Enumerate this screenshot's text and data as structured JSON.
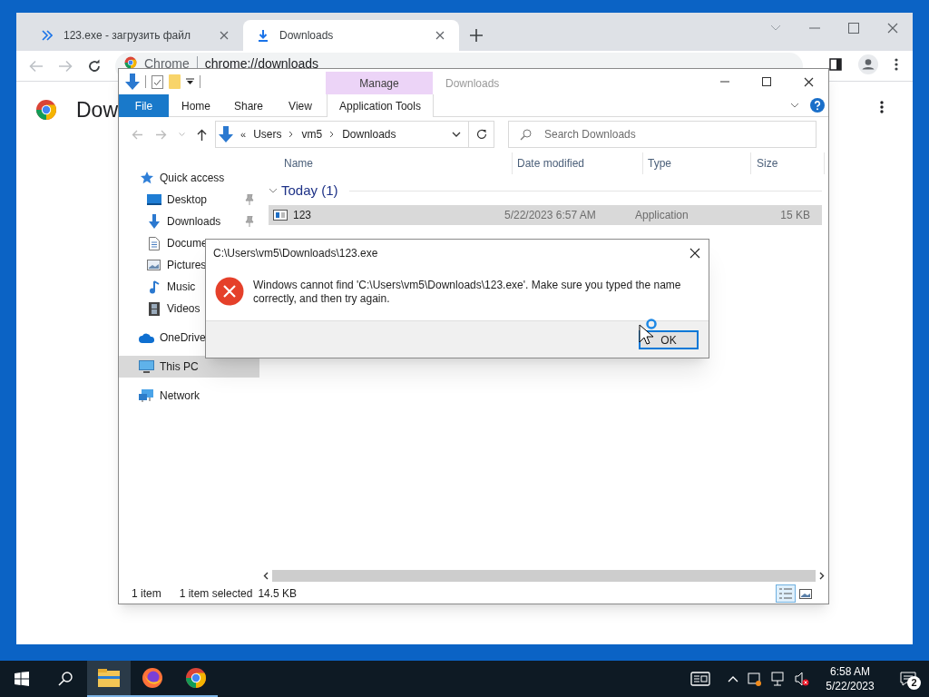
{
  "browser": {
    "tabs": [
      {
        "title": "123.exe - загрузить файл",
        "kind": "site",
        "selected": false
      },
      {
        "title": "Downloads",
        "kind": "downloads",
        "selected": true
      }
    ],
    "omnibox": {
      "site": "Chrome",
      "url": "chrome://downloads"
    },
    "page_heading": "Dow"
  },
  "explorer": {
    "title": "Downloads",
    "context_group": "Manage",
    "ribbon_tabs": [
      {
        "label": "File",
        "kind": "file"
      },
      {
        "label": "Home",
        "kind": "plain"
      },
      {
        "label": "Share",
        "kind": "plain"
      },
      {
        "label": "View",
        "kind": "plain"
      },
      {
        "label": "Application Tools",
        "kind": "contextual"
      }
    ],
    "address": {
      "overflow": "«",
      "crumbs": [
        "Users",
        "vm5",
        "Downloads"
      ]
    },
    "search": {
      "placeholder": "Search Downloads"
    },
    "sidebar": {
      "items": [
        {
          "label": "Quick access",
          "kind": "star",
          "selected": false,
          "children": [
            {
              "label": "Desktop",
              "kind": "desktop",
              "pinned": true,
              "selected": false
            },
            {
              "label": "Downloads",
              "kind": "download",
              "pinned": true,
              "selected": false
            },
            {
              "label": "Docume",
              "kind": "document",
              "selected": false
            },
            {
              "label": "Pictures",
              "kind": "pictures",
              "selected": false
            },
            {
              "label": "Music",
              "kind": "music",
              "selected": false
            },
            {
              "label": "Videos",
              "kind": "videos",
              "selected": false
            }
          ]
        },
        {
          "label": "OneDrive",
          "kind": "cloud",
          "selected": false
        },
        {
          "label": "This PC",
          "kind": "pc",
          "selected": true
        },
        {
          "label": "Network",
          "kind": "network",
          "selected": false
        }
      ]
    },
    "columns": [
      "Name",
      "Date modified",
      "Type",
      "Size"
    ],
    "groups": [
      {
        "label": "Today (1)",
        "expanded": true,
        "rows": [
          {
            "name": "123",
            "date": "5/22/2023 6:57 AM",
            "type": "Application",
            "size": "15 KB",
            "selected": true
          }
        ]
      }
    ],
    "status": {
      "count": "1 item",
      "selection": "1 item selected",
      "size": "14.5 KB"
    }
  },
  "dialog": {
    "title": "C:\\Users\\vm5\\Downloads\\123.exe",
    "message": "Windows cannot find 'C:\\Users\\vm5\\Downloads\\123.exe'. Make sure you typed the name correctly, and then try again.",
    "buttons": [
      {
        "label": "OK",
        "focused": true
      }
    ]
  },
  "taskbar": {
    "apps": [
      {
        "kind": "explorer",
        "active": true
      },
      {
        "kind": "firefox",
        "active": false
      },
      {
        "kind": "chrome",
        "active": false
      }
    ],
    "clock": {
      "time": "6:58 AM",
      "date": "5/22/2023"
    },
    "notifications": "2"
  }
}
